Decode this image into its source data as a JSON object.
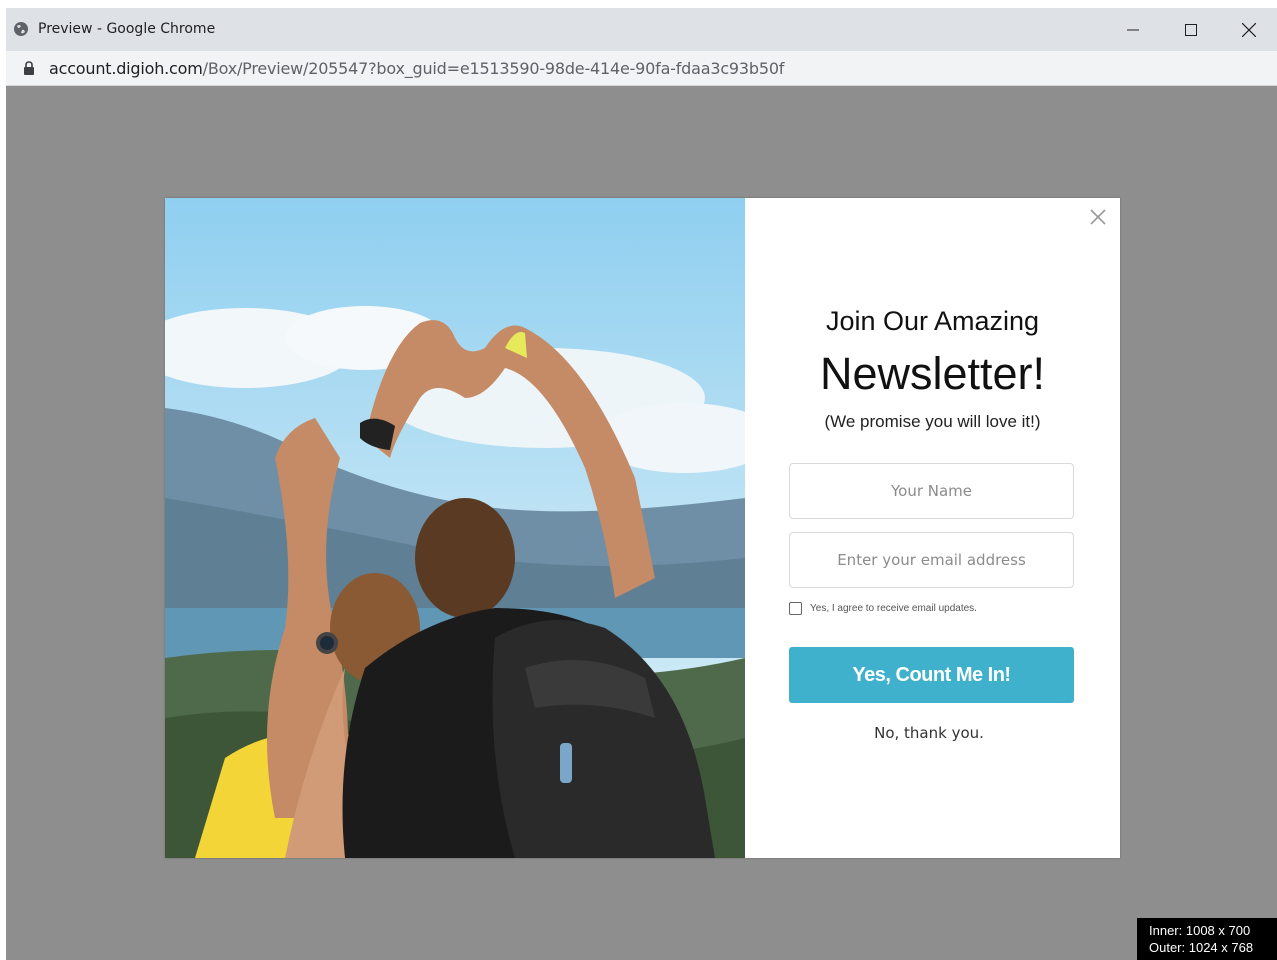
{
  "window": {
    "title": "Preview - Google Chrome",
    "title_icon": "globe-icon",
    "controls": [
      "minimize-icon",
      "maximize-icon",
      "close-icon"
    ]
  },
  "address_bar": {
    "host": "account.digioh.com",
    "path": "/Box/Preview/205547?box_guid=e1513590-98de-414e-90fa-fdaa3c93b50f",
    "icon": "lock-icon"
  },
  "modal": {
    "heading_line1": "Join Our Amazing",
    "heading_line2": "Newsletter!",
    "subheading": "(We promise you will love it!)",
    "name_placeholder": "Your Name",
    "email_placeholder": "Enter your email address",
    "consent_label": "Yes, I agree to receive email updates.",
    "consent_checked": false,
    "submit_label": "Yes, Count Me In!",
    "decline_label": "No, thank you.",
    "close_icon": "close-x-icon",
    "accent_color": "#3fb1cc"
  },
  "size_badge": {
    "inner": "Inner: 1008 x 700",
    "outer": "Outer: 1024 x 768"
  }
}
